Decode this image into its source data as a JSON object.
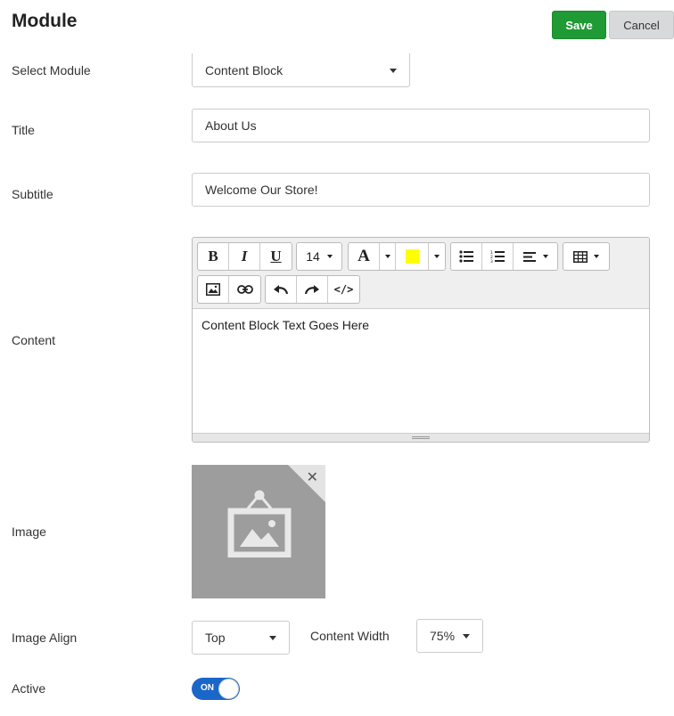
{
  "header": {
    "title": "Module",
    "save_label": "Save",
    "cancel_label": "Cancel"
  },
  "fields": {
    "select_module": {
      "label": "Select Module",
      "value": "Content Block"
    },
    "title": {
      "label": "Title",
      "value": "About Us"
    },
    "subtitle": {
      "label": "Subtitle",
      "value": "Welcome Our Store!"
    },
    "content": {
      "label": "Content",
      "value": "Content Block Text Goes Here"
    },
    "image": {
      "label": "Image"
    },
    "image_align": {
      "label": "Image Align",
      "value": "Top"
    },
    "content_width": {
      "label": "Content Width",
      "value": "75%"
    },
    "active": {
      "label": "Active",
      "state": "ON"
    }
  },
  "editor": {
    "font_size": "14",
    "highlight_color": "#ffff00",
    "toolbar_icons": [
      "bold-icon",
      "italic-icon",
      "underline-icon",
      "font-color-icon",
      "highlight-icon",
      "bullet-list-icon",
      "numbered-list-icon",
      "align-icon",
      "table-icon",
      "image-icon",
      "link-icon",
      "undo-icon",
      "redo-icon",
      "code-view-icon"
    ]
  },
  "colors": {
    "save": "#1f9a35",
    "toggle": "#1b66c9",
    "image_placeholder": "#9d9d9d"
  }
}
